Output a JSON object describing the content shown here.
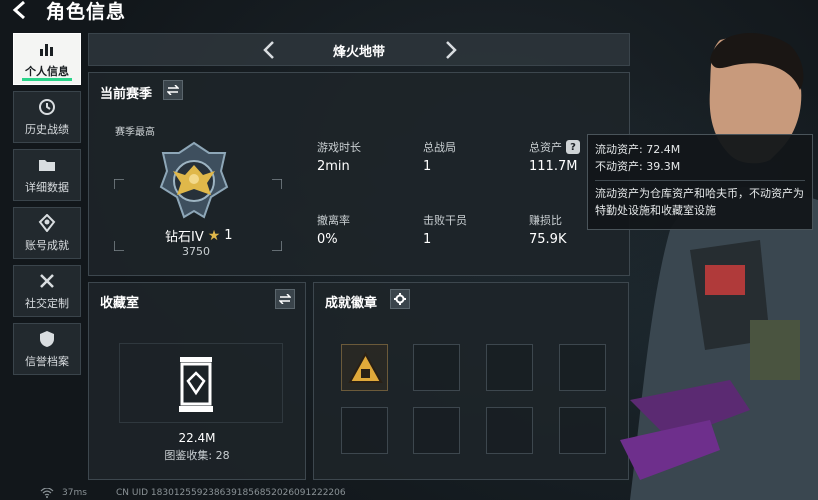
{
  "header": {
    "title": "角色信息"
  },
  "sidebar": {
    "items": [
      {
        "label": "个人信息",
        "icon": "bar-chart-icon",
        "active": true
      },
      {
        "label": "历史战绩",
        "icon": "history-icon"
      },
      {
        "label": "详细数据",
        "icon": "folder-icon"
      },
      {
        "label": "账号成就",
        "icon": "achievement-icon"
      },
      {
        "label": "社交定制",
        "icon": "wrench-icon"
      },
      {
        "label": "信誉档案",
        "icon": "shield-icon"
      }
    ]
  },
  "mode": {
    "name": "烽火地带"
  },
  "season": {
    "title": "当前赛季",
    "best_label": "赛季最高",
    "rank_name": "钻石IV",
    "rank_stars": "1",
    "rank_points": "3750",
    "stats": [
      {
        "label": "游戏时长",
        "value": "2min"
      },
      {
        "label": "总战局",
        "value": "1"
      },
      {
        "label": "总资产",
        "value": "111.7M",
        "help": "?"
      },
      {
        "label": "撤离率",
        "value": "0%"
      },
      {
        "label": "击败干员",
        "value": "1"
      },
      {
        "label": "赚损比",
        "value": "75.9K"
      }
    ]
  },
  "tooltip": {
    "liquid": "流动资产: 72.4M",
    "fixed": "不动资产: 39.3M",
    "desc": "流动资产为仓库资产和哈夫币，不动资产为特勤处设施和收藏室设施"
  },
  "collection": {
    "title": "收藏室",
    "value": "22.4M",
    "count": "图鉴收集: 28"
  },
  "achievements": {
    "title": "成就徽章"
  },
  "status": {
    "ping": "37ms",
    "uid": "CN UID 1830125592386391856852026091222206"
  },
  "colors": {
    "accent": "#2bd48a",
    "gold": "#e0b84a",
    "panel": "#1e2429"
  }
}
